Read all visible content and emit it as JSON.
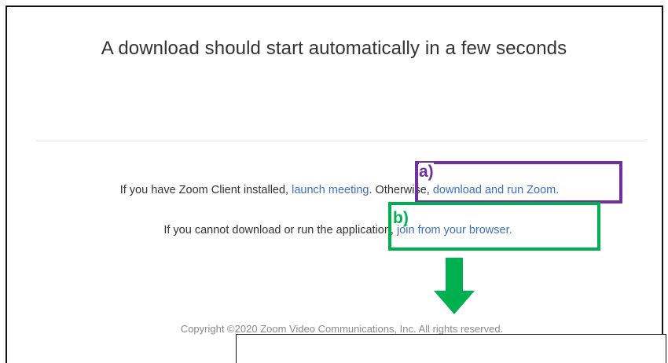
{
  "heading": "A download should start automatically in a few seconds",
  "line1": {
    "prefix": "If you have Zoom Client installed,",
    "launch_link": "launch meeting",
    "middle": ". Otherwise,",
    "download_link": "download and run Zoom",
    "suffix": "."
  },
  "line2": {
    "prefix": "If you cannot download or run the application,",
    "browser_link": "join from your browser",
    "suffix": "."
  },
  "copyright": "Copyright ©2020 Zoom Video Communications, Inc. All rights reserved.",
  "annotations": {
    "a_label": "a)",
    "b_label": "b)",
    "a_color": "#7030a0",
    "b_color": "#00b050",
    "arrow_icon": "down-arrow-icon"
  },
  "colors": {
    "link": "#3b6fc2",
    "text": "#333333",
    "muted": "#8a8a8a"
  }
}
